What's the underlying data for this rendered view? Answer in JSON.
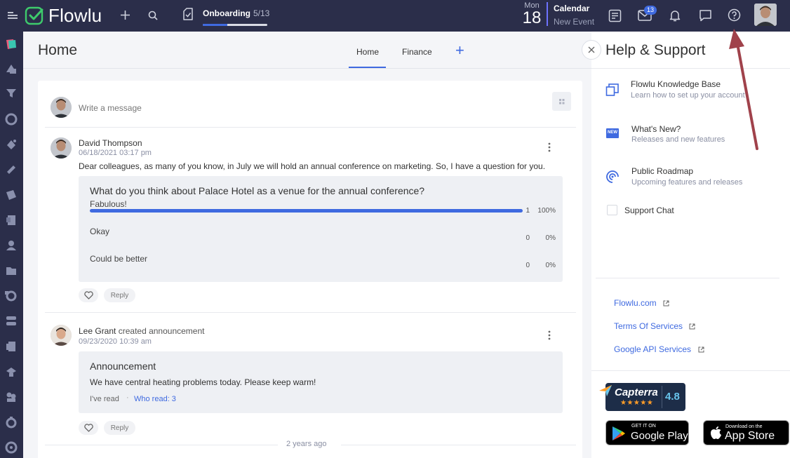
{
  "topbar": {
    "logo": "Flowlu",
    "onboarding": {
      "label": "Onboarding",
      "count": "5/13",
      "progress": 0.38
    },
    "calendar": {
      "weekday": "Mon",
      "day": "18",
      "title": "Calendar",
      "subtitle": "New Event"
    },
    "mail_badge": "13"
  },
  "main": {
    "title": "Home",
    "tabs": [
      {
        "label": "Home"
      },
      {
        "label": "Finance"
      }
    ],
    "compose_placeholder": "Write a message",
    "posts": [
      {
        "author": "David Thompson",
        "date": "06/18/2021 03:17 pm",
        "text": "Dear colleagues, as many of you know, in July we will hold an annual conference on marketing. So, I have a question for you.",
        "poll": {
          "question": "What do you think about Palace Hotel as a venue for the annual conference?",
          "options": [
            {
              "label": "Fabulous!",
              "votes": "1",
              "percent": "100%",
              "fraction": 1.0
            },
            {
              "label": "Okay",
              "votes": "0",
              "percent": "0%",
              "fraction": 0
            },
            {
              "label": "Could be better",
              "votes": "0",
              "percent": "0%",
              "fraction": 0
            }
          ]
        },
        "reply_label": "Reply"
      },
      {
        "author": "Lee Grant",
        "action": "created announcement",
        "date": "09/23/2020 10:39 am",
        "announcement": {
          "title": "Announcement",
          "text": "We have central heating problems today. Please keep warm!",
          "read_label": "I've read",
          "who_read": "Who read: 3"
        },
        "reply_label": "Reply"
      }
    ],
    "separator_label": "2 years ago"
  },
  "help": {
    "title": "Help & Support",
    "items": [
      {
        "title": "Flowlu Knowledge Base",
        "subtitle": "Learn how to set up your account"
      },
      {
        "title": "What's New?",
        "subtitle": "Releases and new features"
      },
      {
        "title": "Public Roadmap",
        "subtitle": "Upcoming features and releases"
      },
      {
        "title": "Support Chat"
      }
    ],
    "links": [
      {
        "label": "Flowlu.com"
      },
      {
        "label": "Terms Of Services"
      },
      {
        "label": "Google API Services"
      }
    ],
    "capterra": {
      "name": "Capterra",
      "rating": "4.8"
    },
    "google_play": {
      "small": "GET IT ON",
      "big": "Google Play"
    },
    "app_store": {
      "small": "Download on the",
      "big": "App Store"
    },
    "whatsnew_icon_text": "NEW"
  },
  "colors": {
    "topbar": "#2b2e4a",
    "accent": "#3f6ae0",
    "logo_green": "#3ecb6c",
    "arrow": "#a0424b"
  }
}
